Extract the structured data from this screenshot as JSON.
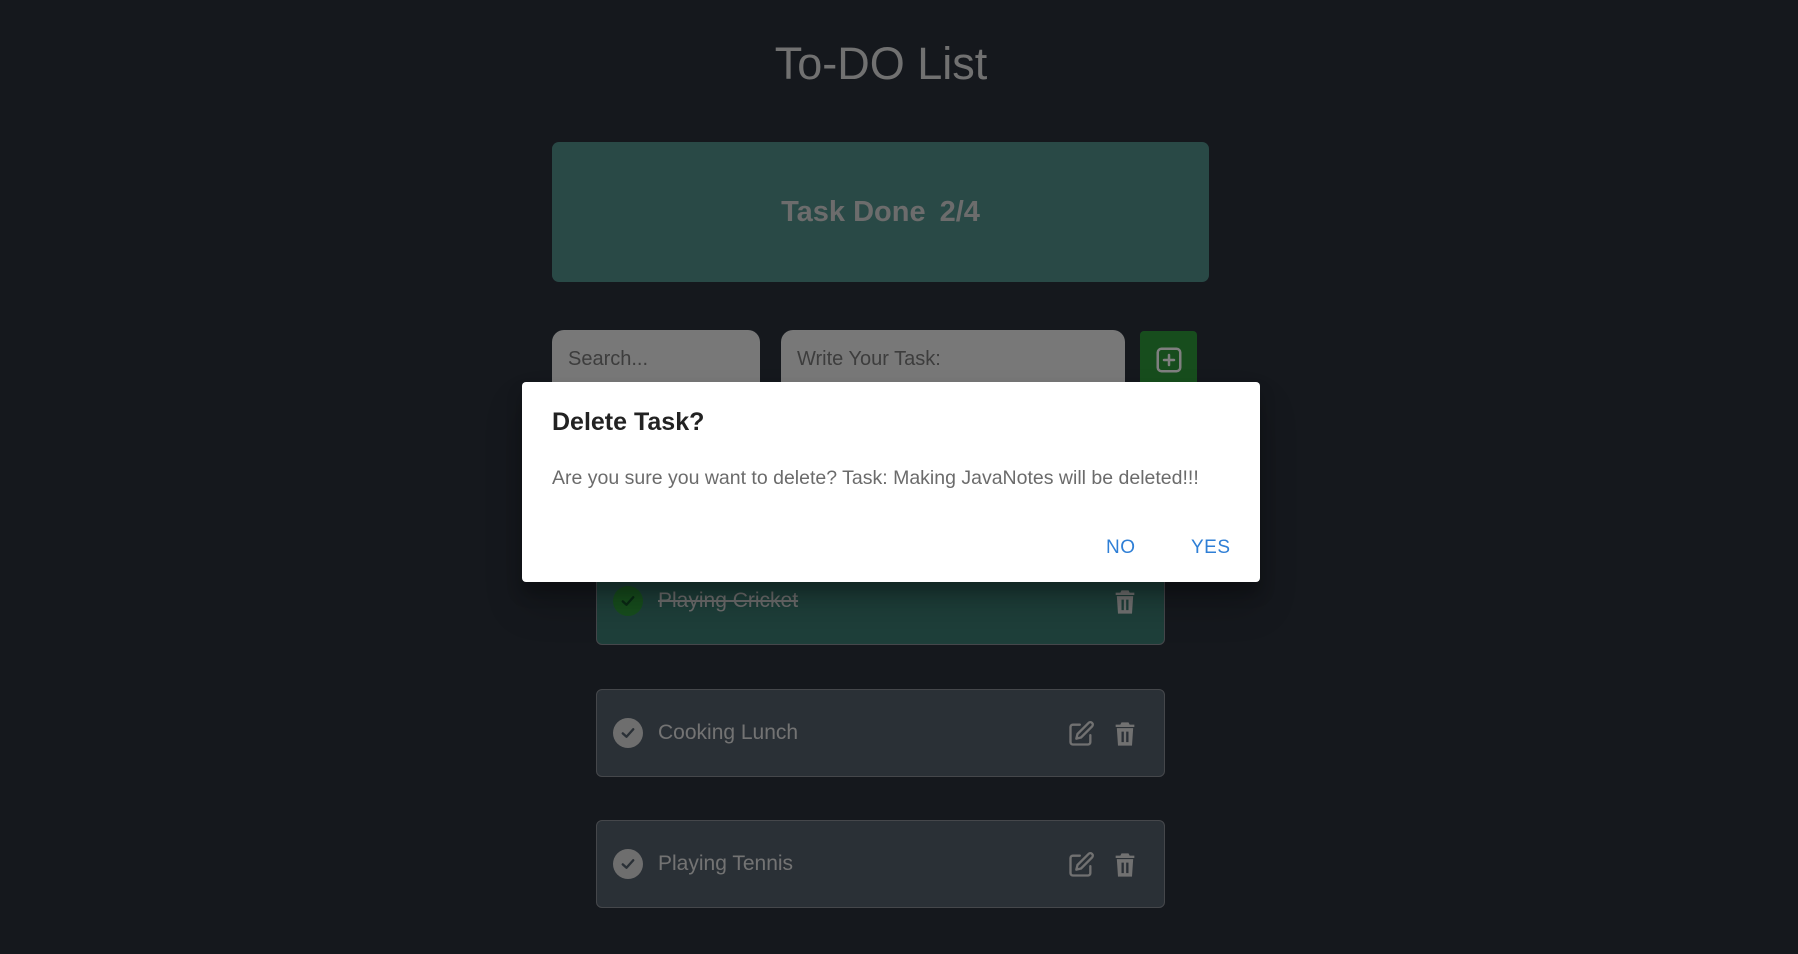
{
  "page": {
    "title": "To-DO List"
  },
  "progress": {
    "label": "Task Done",
    "count": "2/4",
    "completed": 2,
    "total": 4
  },
  "search": {
    "placeholder": "Search..."
  },
  "new_task": {
    "placeholder": "Write Your Task:"
  },
  "add_button": {
    "icon": "plus-square-icon"
  },
  "tasks": [
    {
      "label": "Playing Cricket",
      "done": true,
      "actions": [
        "delete"
      ]
    },
    {
      "label": "Cooking Lunch",
      "done": false,
      "actions": [
        "edit",
        "delete"
      ]
    },
    {
      "label": "Playing Tennis",
      "done": false,
      "actions": [
        "edit",
        "delete"
      ]
    }
  ],
  "dialog": {
    "title": "Delete Task?",
    "message": "Are you sure you want to delete? Task: Making JavaNotes will be deleted!!!",
    "no_label": "NO",
    "yes_label": "YES"
  },
  "colors": {
    "background": "#2a303b",
    "progress_card": "#52938c",
    "done_task": "#3d7f74",
    "open_task": "#55606d",
    "add_button": "#2f9a3b",
    "dialog_action": "#2f7fd6"
  }
}
